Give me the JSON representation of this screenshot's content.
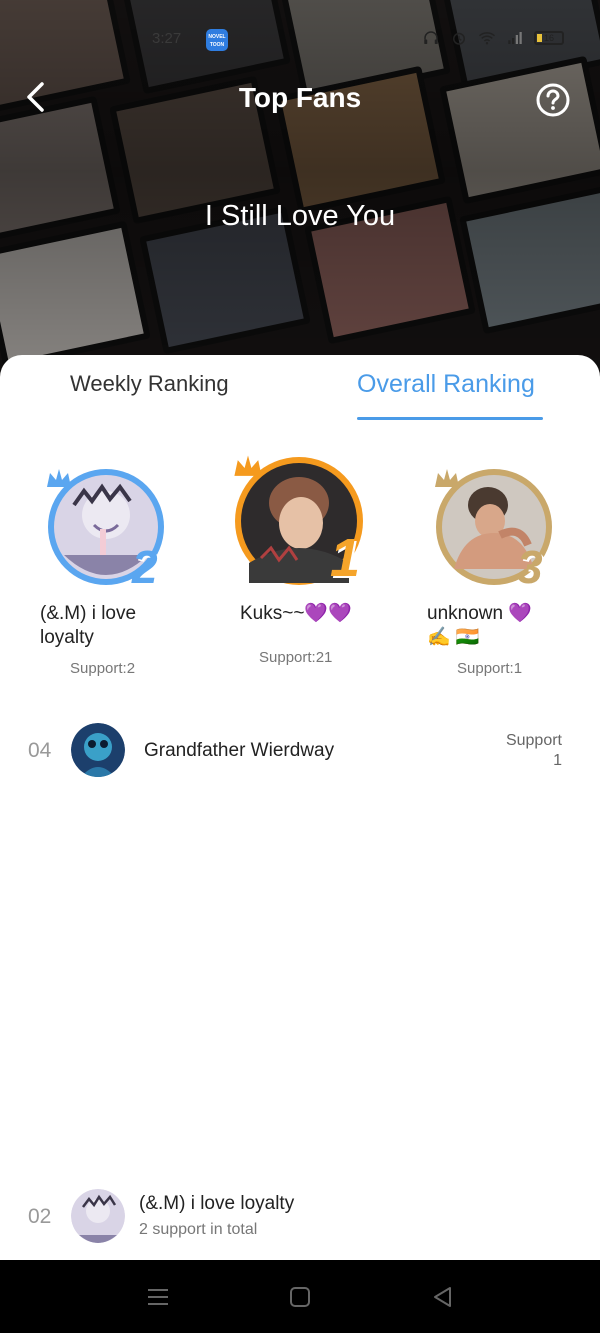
{
  "status_bar": {
    "time": "3:27",
    "app_badge": "NOVEL TOON",
    "battery": "16"
  },
  "header": {
    "title": "Top Fans",
    "back_icon": "chevron-left-icon",
    "help_icon": "question-circle-icon"
  },
  "book": {
    "title": "I Still Love You"
  },
  "tabs": [
    {
      "label": "Weekly Ranking",
      "active": false
    },
    {
      "label": "Overall Ranking",
      "active": true
    }
  ],
  "podium": [
    {
      "rank": "2",
      "name": "(&.M) i love loyalty",
      "support": "Support:2",
      "ring_color": "#5aa6f0"
    },
    {
      "rank": "1",
      "name": "Kuks~~💜💜",
      "support": "Support:21",
      "ring_color": "#f59a1e"
    },
    {
      "rank": "3",
      "name": "unknown 💜 ✍️ 🇮🇳",
      "support": "Support:1",
      "ring_color": "#c9a86a"
    }
  ],
  "list": [
    {
      "rank": "04",
      "name": "Grandfather Wierdway",
      "support_label": "Support",
      "support_value": "1"
    }
  ],
  "my_rank": {
    "rank": "02",
    "name": "(&.M) i love loyalty",
    "summary": "2 support in total"
  },
  "colors": {
    "accent": "#4a9be8",
    "gold": "#f59a1e",
    "silver": "#5aa6f0",
    "bronze": "#c9a86a"
  }
}
